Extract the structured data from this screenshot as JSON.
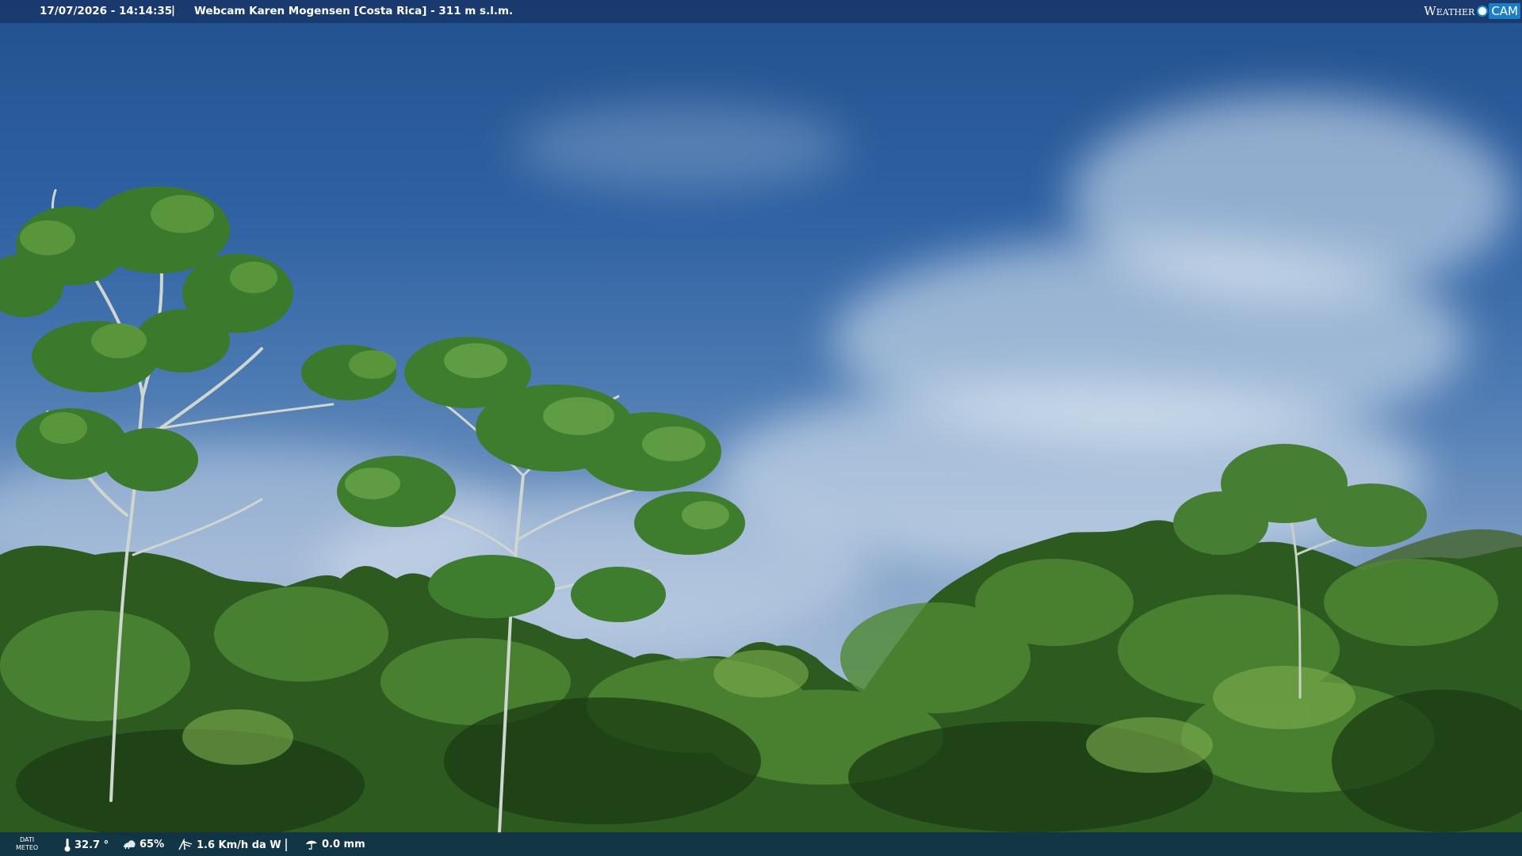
{
  "header": {
    "datetime": "17/07/2026 - 14:14:35",
    "separator": "|",
    "caption": "Webcam Karen Mogensen [Costa Rica] - 311 m s.l.m."
  },
  "logo": {
    "weather": "Weather",
    "cam": "CAM"
  },
  "footer": {
    "label_line1": "DATI",
    "label_line2": "METEO",
    "temperature": "32.7 °",
    "humidity": "65%",
    "wind": "1.6 Km/h da W",
    "rain": "0.0 mm"
  },
  "icons": {
    "temperature": "thermometer-icon",
    "humidity": "humidity-icon",
    "wind": "wind-icon",
    "rain": "rain-icon"
  }
}
